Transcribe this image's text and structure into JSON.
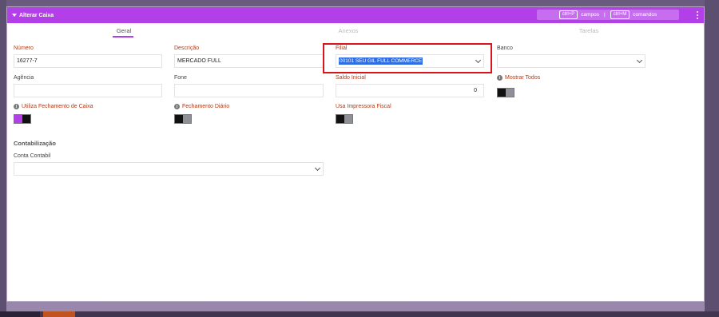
{
  "window": {
    "title": "Alterar Caixa",
    "shortcuts": {
      "key1": "ctrl+P",
      "label1": "campos",
      "separator": "|",
      "key2": "ctrl+M",
      "label2": "comandos"
    }
  },
  "tabs": [
    {
      "label": "Geral",
      "active": true
    },
    {
      "label": "Anexos",
      "active": false
    },
    {
      "label": "Tarefas",
      "active": false
    }
  ],
  "fields": {
    "numero": {
      "label": "Número",
      "value": "16277-7"
    },
    "descricao": {
      "label": "Descrição",
      "value": "MERCADO FULL"
    },
    "filial": {
      "label": "Filial",
      "value": "00101 SEU GIL FULL COMMERCE"
    },
    "banco": {
      "label": "Banco",
      "value": ""
    },
    "agencia": {
      "label": "Agência",
      "value": ""
    },
    "fone": {
      "label": "Fone",
      "value": ""
    },
    "saldo_inicial": {
      "label": "Saldo Inicial",
      "value": "0"
    },
    "mostrar_todos": {
      "label": "Mostrar Todos",
      "state": "off"
    },
    "utiliza_fechamento": {
      "label": "Utiliza Fechamento de Caixa",
      "state": "on"
    },
    "fechamento_diario": {
      "label": "Fechamento Diário",
      "state": "off"
    },
    "usa_impressora": {
      "label": "Usa Impressora Fiscal",
      "state": "off"
    }
  },
  "contabilizacao": {
    "title": "Contabilização",
    "conta_contabil": {
      "label": "Conta Contabil",
      "value": ""
    }
  },
  "colors": {
    "titlebar": "#b23fe8",
    "accent": "#b23fe8",
    "required_label": "#b33a17",
    "highlight_frame": "#d9141b"
  }
}
